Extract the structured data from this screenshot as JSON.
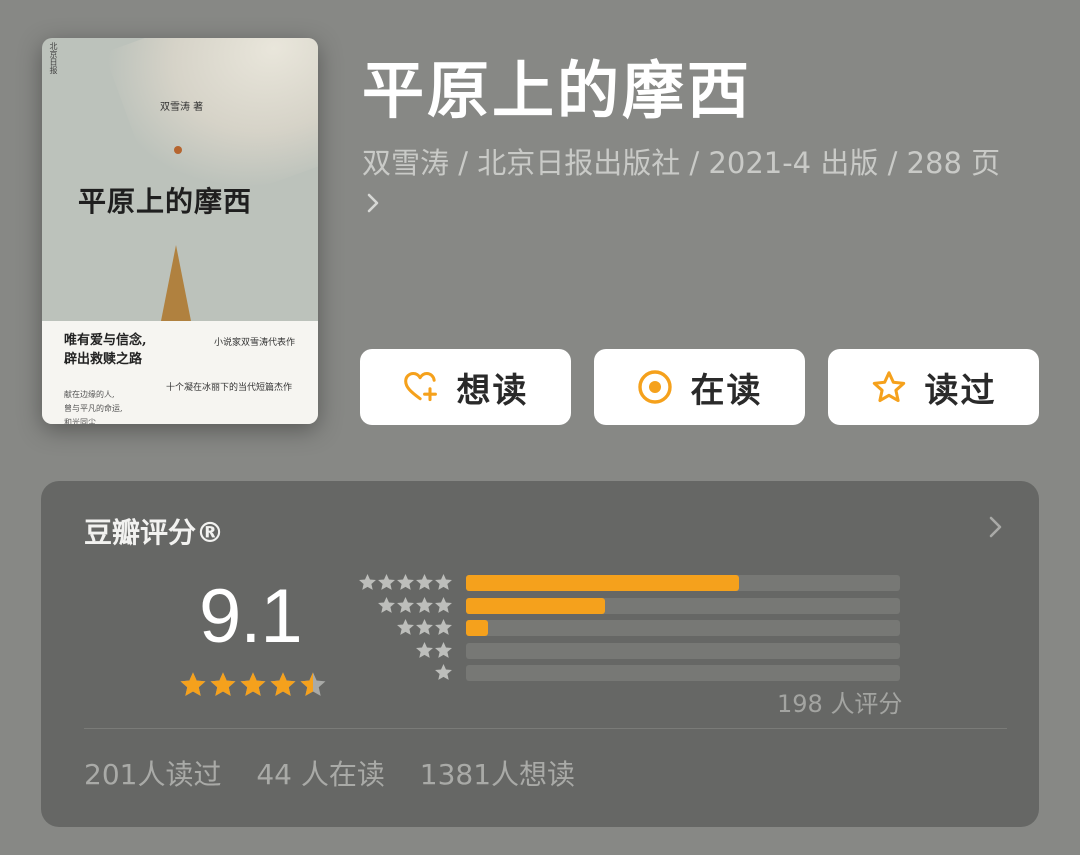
{
  "book": {
    "title": "平原上的摩西",
    "meta": "双雪涛 / 北京日报出版社 / 2021-4 出版 / 288 页",
    "cover": {
      "author_line": "双雪涛 著",
      "title": "平原上的摩西",
      "slogan_line1": "唯有爱与信念,",
      "slogan_line2": "辟出救赎之路",
      "sub1": "小说家双雪涛代表作",
      "sub2": "十个凝在冰丽下的当代短篇杰作",
      "blurb_line1": "献在边缘的人,",
      "blurb_line2": "曾与平凡的命运,",
      "blurb_line3": "和光同尘",
      "vertical_mark": "北京日报"
    }
  },
  "actions": {
    "want": {
      "label": "想读",
      "icon": "heart-plus-icon"
    },
    "reading": {
      "label": "在读",
      "icon": "target-circle-icon"
    },
    "read": {
      "label": "读过",
      "icon": "star-outline-icon"
    }
  },
  "rating": {
    "title": "豆瓣评分®",
    "score": "9.1",
    "stars": 4.5,
    "distribution": [
      {
        "stars": 5,
        "fraction": 0.63
      },
      {
        "stars": 4,
        "fraction": 0.32
      },
      {
        "stars": 3,
        "fraction": 0.05
      },
      {
        "stars": 2,
        "fraction": 0.0
      },
      {
        "stars": 1,
        "fraction": 0.0
      }
    ],
    "count": "198 人评分",
    "stats": {
      "read": "201人读过",
      "reading": "44 人在读",
      "want": "1381人想读"
    }
  },
  "colors": {
    "accent": "#f5a11c",
    "background": "#878885",
    "card": "#666765"
  }
}
